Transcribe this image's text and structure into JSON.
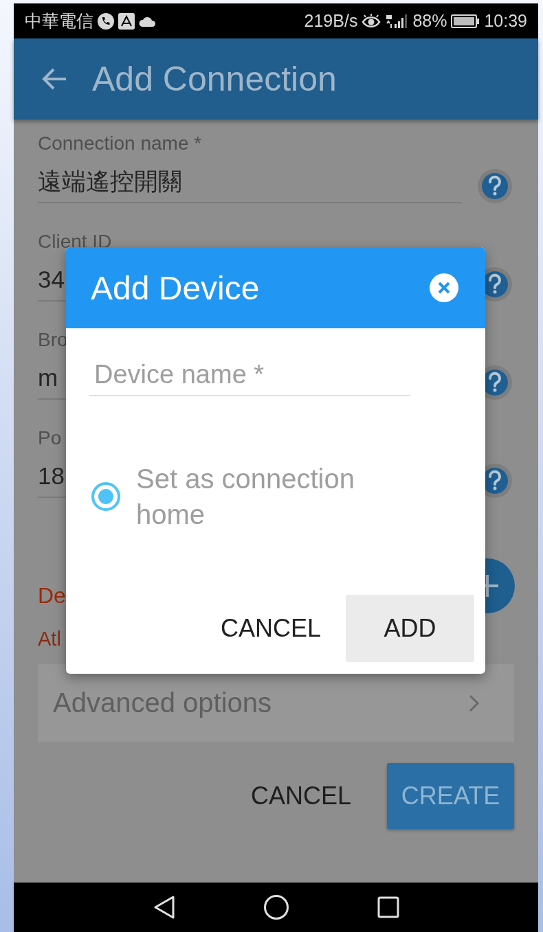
{
  "status_bar": {
    "carrier": "中華電信",
    "speed": "219B/s",
    "battery": "88%",
    "time": "10:39"
  },
  "app_bar": {
    "title": "Add Connection"
  },
  "form": {
    "fields": [
      {
        "label": "Connection name",
        "marker": "*",
        "value": "遠端遙控開關"
      },
      {
        "label": "Client ID",
        "value": "34"
      },
      {
        "label": "Bro",
        "value": "m"
      },
      {
        "label": "Po",
        "value": "18"
      }
    ],
    "section": {
      "title": "De",
      "hint": "Atl"
    },
    "advanced_options": "Advanced options",
    "buttons": [
      {
        "label": "CANCEL",
        "kind": "text"
      },
      {
        "label": "CREATE",
        "kind": "raised"
      }
    ]
  },
  "dialog": {
    "title": "Add Device",
    "field": {
      "placeholder": "Device name *"
    },
    "radio": {
      "label": "Set as connection home",
      "selected": true
    },
    "buttons": [
      {
        "label": "CANCEL",
        "kind": "text"
      },
      {
        "label": "ADD",
        "kind": "raised"
      }
    ]
  }
}
